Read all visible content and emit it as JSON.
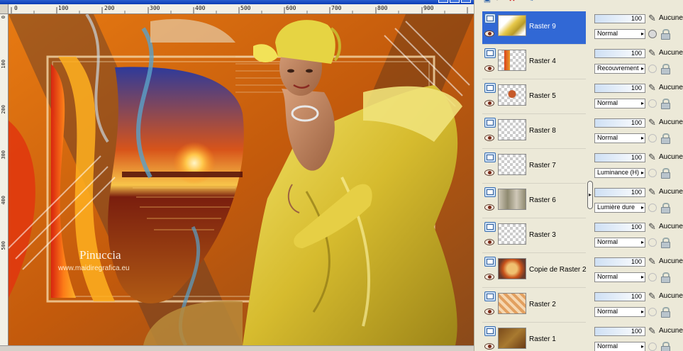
{
  "ruler": {
    "top_labels": [
      "0",
      "100",
      "200",
      "300",
      "400",
      "500",
      "600",
      "700",
      "800",
      "900"
    ],
    "left_labels": [
      "0",
      "100",
      "200",
      "300",
      "400",
      "500"
    ]
  },
  "artwork": {
    "signature": "Pinuccia",
    "website": "www.maidiregrafica.eu"
  },
  "colors": {
    "selected_row": "#3168d5",
    "panel_bg": "#ece9d8",
    "title_bar": "#0a3cb4"
  },
  "layers": [
    {
      "name": "Raster 9",
      "opacity": "100",
      "blend": "Normal",
      "mask": "Aucune",
      "selected": true,
      "thumb": "woman"
    },
    {
      "name": "Raster 4",
      "opacity": "100",
      "blend": "Recouvrement",
      "mask": "Aucune",
      "selected": false,
      "thumb": "stripe"
    },
    {
      "name": "Raster 5",
      "opacity": "100",
      "blend": "Normal",
      "mask": "Aucune",
      "selected": false,
      "thumb": "small"
    },
    {
      "name": "Raster 8",
      "opacity": "100",
      "blend": "Normal",
      "mask": "Aucune",
      "selected": false,
      "thumb": "empty"
    },
    {
      "name": "Raster 7",
      "opacity": "100",
      "blend": "Luminance (H)",
      "mask": "Aucune",
      "selected": false,
      "thumb": "empty"
    },
    {
      "name": "Raster 6",
      "opacity": "100",
      "blend": "Lumière dure",
      "mask": "Aucune",
      "selected": false,
      "thumb": "grey"
    },
    {
      "name": "Raster 3",
      "opacity": "100",
      "blend": "Normal",
      "mask": "Aucune",
      "selected": false,
      "thumb": "empty"
    },
    {
      "name": "Copie de Raster 2",
      "opacity": "100",
      "blend": "Normal",
      "mask": "Aucune",
      "selected": false,
      "thumb": "frame"
    },
    {
      "name": "Raster 2",
      "opacity": "100",
      "blend": "Normal",
      "mask": "Aucune",
      "selected": false,
      "thumb": "pattern"
    },
    {
      "name": "Raster 1",
      "opacity": "100",
      "blend": "Normal",
      "mask": "Aucune",
      "selected": false,
      "thumb": "brown"
    }
  ]
}
